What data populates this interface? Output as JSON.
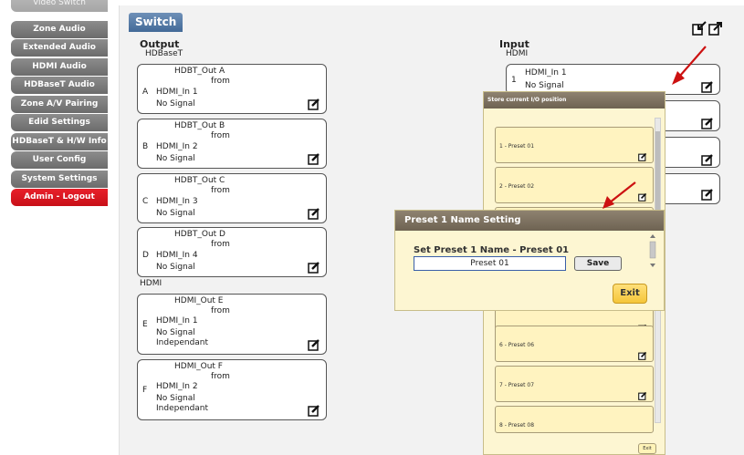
{
  "sidebar": {
    "items": [
      {
        "label": "Video Switch"
      },
      {
        "label": "Zone Audio"
      },
      {
        "label": "Extended Audio"
      },
      {
        "label": "HDMI Audio"
      },
      {
        "label": "HDBaseT Audio"
      },
      {
        "label": "Zone A/V Pairing"
      },
      {
        "label": "Edid Settings"
      },
      {
        "label": "HDBaseT & H/W Info"
      },
      {
        "label": "User Config"
      },
      {
        "label": "System Settings"
      },
      {
        "label": "Admin - Logout"
      }
    ]
  },
  "main": {
    "tab_label": "Switch",
    "output": {
      "title": "Output",
      "hdbaset_label": "HDBaseT",
      "hdmi_label": "HDMI",
      "boxes": [
        {
          "letter": "A",
          "name": "HDBT_Out A",
          "from": "from",
          "input": "HDMI_In 1",
          "status": "No Signal",
          "mode": ""
        },
        {
          "letter": "B",
          "name": "HDBT_Out B",
          "from": "from",
          "input": "HDMI_In 2",
          "status": "No Signal",
          "mode": ""
        },
        {
          "letter": "C",
          "name": "HDBT_Out C",
          "from": "from",
          "input": "HDMI_In 3",
          "status": "No Signal",
          "mode": ""
        },
        {
          "letter": "D",
          "name": "HDBT_Out D",
          "from": "from",
          "input": "HDMI_In 4",
          "status": "No Signal",
          "mode": ""
        },
        {
          "letter": "E",
          "name": "HDMI_Out E",
          "from": "from",
          "input": "HDMI_In 1",
          "status": "No Signal",
          "mode": "Independant"
        },
        {
          "letter": "F",
          "name": "HDMI_Out F",
          "from": "from",
          "input": "HDMI_In 2",
          "status": "No Signal",
          "mode": "Independant"
        }
      ]
    },
    "input": {
      "title": "Input",
      "hdmi_label": "HDMI",
      "boxes": [
        {
          "number": "1",
          "name": "HDMI_In 1",
          "status": "No Signal"
        }
      ]
    }
  },
  "store_panel": {
    "title": "Store current I/O position",
    "presets": [
      {
        "label": "1 - Preset 01"
      },
      {
        "label": "2 - Preset 02"
      },
      {
        "label": "6 - Preset 06"
      },
      {
        "label": "7 - Preset 07"
      },
      {
        "label": "8 - Preset 08"
      }
    ],
    "exit_label": "Exit"
  },
  "name_dialog": {
    "title": "Preset 1 Name Setting",
    "field_label": "Set Preset 1 Name - Preset 01",
    "field_value": "Preset 01",
    "save_label": "Save",
    "exit_label": "Exit"
  },
  "colors": {
    "nav_default": "#7c7c7c",
    "nav_logout": "#e01820",
    "tab_blue": "#4f76a4",
    "panel_bg": "#fdf6d2",
    "arrow_red": "#cc1111"
  }
}
